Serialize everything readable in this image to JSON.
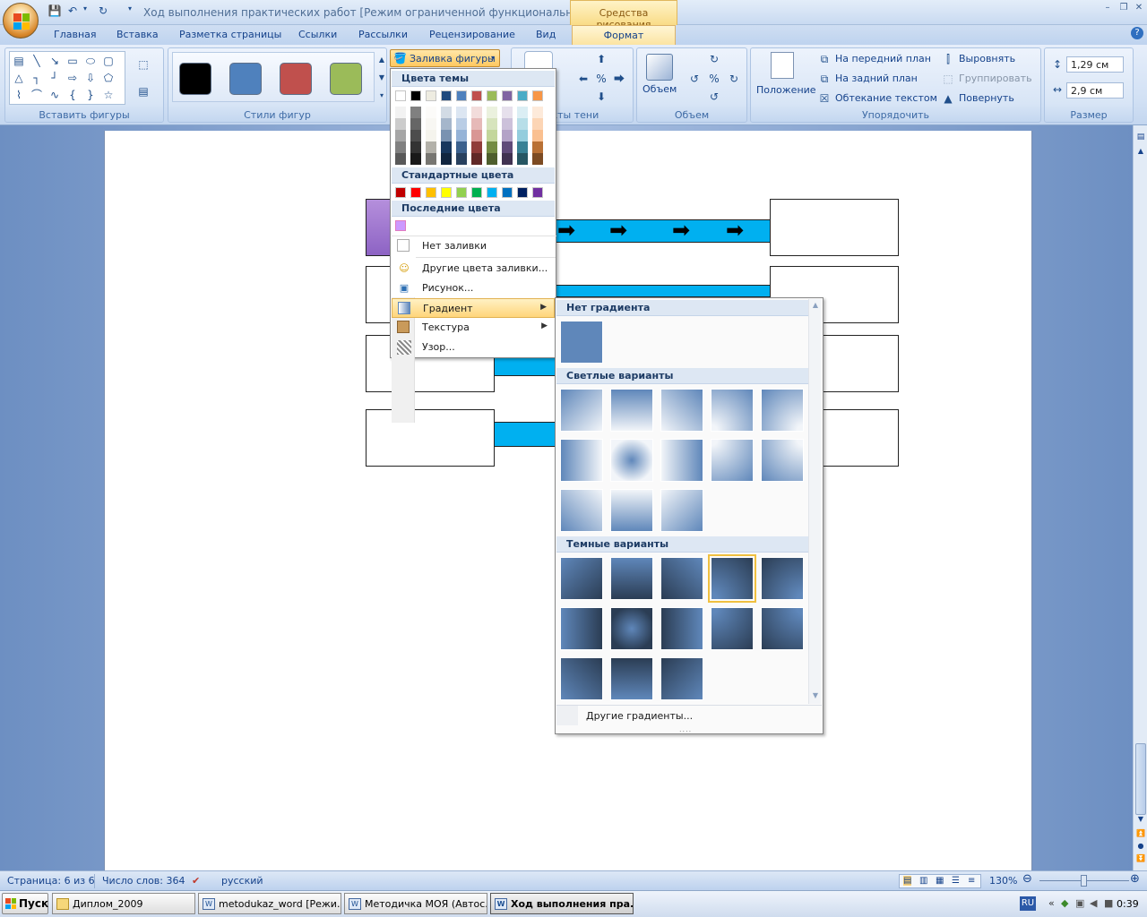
{
  "window": {
    "title": "Ход выполнения практических работ [Режим ограниченной функциональности] - M.",
    "context_tab": "Средства рисования"
  },
  "tabs": [
    "Главная",
    "Вставка",
    "Разметка страницы",
    "Ссылки",
    "Рассылки",
    "Рецензирование",
    "Вид"
  ],
  "active_tab": "Формат",
  "ribbon": {
    "groups": {
      "insert_shapes": "Вставить фигуры",
      "shape_styles": "Стили фигур",
      "shadow": "екты тени",
      "volume": "Объем",
      "arrange": "Упорядочить",
      "size": "Размер"
    },
    "fill_button": "Заливка фигуры",
    "volume_button": "Объем",
    "position_button": "Положение",
    "bring_front": "На передний план",
    "send_back": "На задний план",
    "text_wrap": "Обтекание текстом",
    "align": "Выровнять",
    "group": "Группировать",
    "rotate": "Повернуть",
    "height": "1,29 см",
    "width": "2,9 см",
    "style_colors": [
      "#000000",
      "#4f81bd",
      "#c0504d",
      "#9bbb59"
    ]
  },
  "fill_menu": {
    "theme_colors_label": "Цвета темы",
    "standard_colors_label": "Стандартные цвета",
    "recent_colors_label": "Последние цвета",
    "theme_top": [
      "#ffffff",
      "#000000",
      "#eeece1",
      "#1f497d",
      "#4f81bd",
      "#c0504d",
      "#9bbb59",
      "#8064a2",
      "#4bacc6",
      "#f79646"
    ],
    "standard": [
      "#c00000",
      "#ff0000",
      "#ffc000",
      "#ffff00",
      "#92d050",
      "#00b050",
      "#00b0f0",
      "#0070c0",
      "#002060",
      "#7030a0"
    ],
    "recent": [
      "#cc99ff"
    ],
    "items": [
      {
        "label": "Нет заливки",
        "icon": "no-fill-icon"
      },
      {
        "label": "Другие цвета заливки...",
        "icon": "palette-icon"
      },
      {
        "label": "Рисунок...",
        "icon": "picture-icon"
      },
      {
        "label": "Градиент",
        "icon": "gradient-icon",
        "submenu": true
      },
      {
        "label": "Текстура",
        "icon": "texture-icon",
        "submenu": true
      },
      {
        "label": "Узор...",
        "icon": "pattern-icon"
      }
    ]
  },
  "gradient_menu": {
    "no_gradient_label": "Нет градиента",
    "light_label": "Светлые варианты",
    "dark_label": "Темные варианты",
    "more_label": "Другие градиенты...",
    "base_color": "#5f87ba",
    "light_count": 13,
    "dark_count": 13,
    "selected_dark_index": 3
  },
  "statusbar": {
    "page": "Страница: 6 из 6",
    "words": "Число слов: 364",
    "language": "русский",
    "zoom": "130%"
  },
  "taskbar": {
    "start": "Пуск",
    "tasks": [
      "Диплом_2009",
      "metodukaz_word [Режи...",
      "Методичка МОЯ (Автос...",
      "Ход выполнения пра..."
    ],
    "lang": "RU",
    "time": "0:39"
  }
}
